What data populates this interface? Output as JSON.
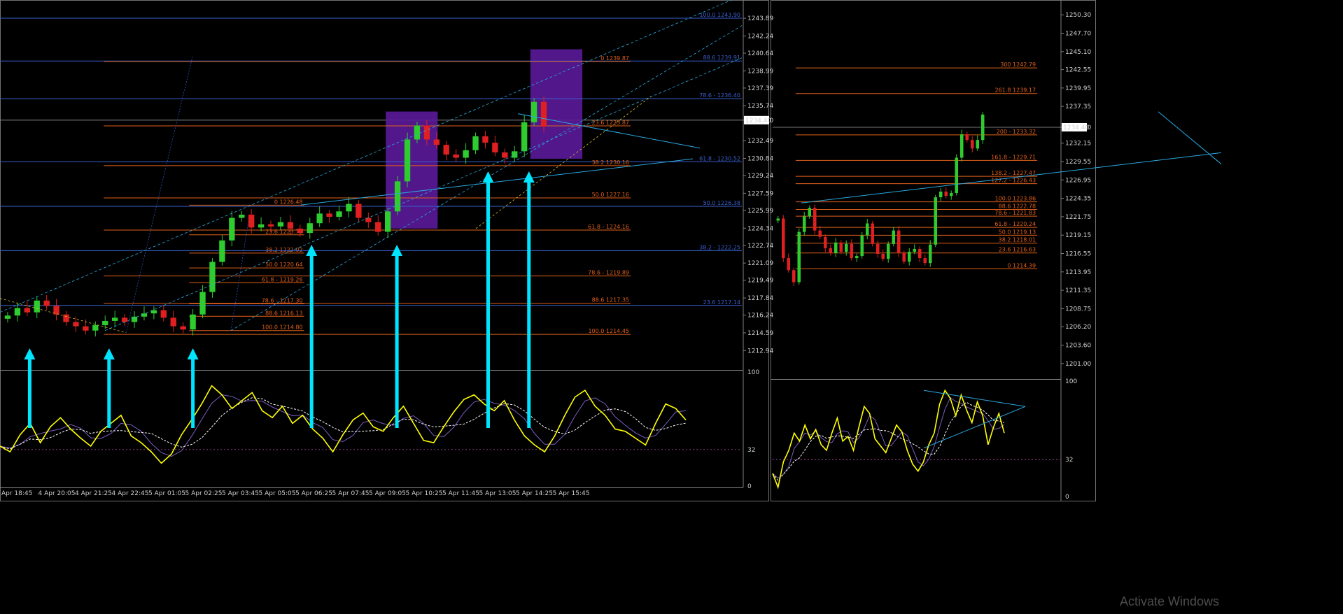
{
  "colors": {
    "background": "#000000",
    "bull": "#2ecc2e",
    "bear": "#e02020",
    "fib_blue": "#3a5fd0",
    "fib_orange": "#e0601a",
    "trend": "#2aa8e0",
    "arrow": "#00e5ff",
    "box": "#5a1a9a",
    "osc_main": "#ffff00",
    "osc_sig": "#7a5cc0",
    "osc_dash": "#ffffff",
    "axis_text": "#d0d0d0"
  },
  "watermark": "Activate Windows",
  "chart_data": [
    {
      "name": "left-price",
      "type": "candlestick",
      "ylim": [
        1211.2,
        1245.2
      ],
      "y_ticks": [
        "1243.89",
        "1242.24",
        "1240.64",
        "1238.99",
        "1237.39",
        "1235.74",
        "1234.40",
        "1232.49",
        "1230.84",
        "1229.24",
        "1227.59",
        "1225.99",
        "1224.34",
        "1222.74",
        "1221.09",
        "1219.49",
        "1217.84",
        "1216.24",
        "1214.59",
        "1212.94"
      ],
      "current_price": "1234.40",
      "x_ticks": [
        "Apr 18:45",
        "4 Apr 20:05",
        "4 Apr 21:25",
        "4 Apr 22:45",
        "5 Apr 01:05",
        "5 Apr 02:25",
        "5 Apr 03:45",
        "5 Apr 05:05",
        "5 Apr 06:25",
        "5 Apr 07:45",
        "5 Apr 09:05",
        "5 Apr 10:25",
        "5 Apr 11:45",
        "5 Apr 13:05",
        "5 Apr 14:25",
        "5 Apr 15:45"
      ],
      "close_path": [
        1216.2,
        1216.9,
        1216.5,
        1217.6,
        1217.1,
        1216.3,
        1215.6,
        1215.2,
        1214.8,
        1215.3,
        1215.7,
        1216.0,
        1215.6,
        1216.1,
        1216.4,
        1216.7,
        1216.0,
        1215.2,
        1214.9,
        1216.3,
        1218.4,
        1221.2,
        1223.2,
        1225.3,
        1225.6,
        1224.4,
        1224.7,
        1224.5,
        1224.9,
        1224.3,
        1223.9,
        1224.8,
        1225.7,
        1225.4,
        1225.9,
        1226.6,
        1225.3,
        1224.9,
        1224.0,
        1225.9,
        1228.7,
        1232.6,
        1233.9,
        1232.6,
        1232.1,
        1231.2,
        1230.9,
        1231.6,
        1232.9,
        1232.3,
        1231.4,
        1230.9,
        1231.5,
        1234.2,
        1236.1,
        1233.8
      ],
      "fib_levels": [
        {
          "label": "100.0 1243.90",
          "value": 1243.9,
          "color": "blue",
          "x0": 0.0,
          "x1": 1.0
        },
        {
          "label": "88.6 1239.91",
          "value": 1239.91,
          "color": "blue",
          "x0": 0.0,
          "x1": 1.0
        },
        {
          "label": "0 1239.87",
          "value": 1239.87,
          "color": "orange",
          "x0": 0.14,
          "x1": 0.85
        },
        {
          "label": "78.6 - 1236.40",
          "value": 1236.4,
          "color": "blue",
          "x0": 0.0,
          "x1": 1.0
        },
        {
          "label": "23.6 1233.87",
          "value": 1233.87,
          "color": "orange",
          "x0": 0.14,
          "x1": 0.85
        },
        {
          "label": "61.8 - 1230.52",
          "value": 1230.52,
          "color": "blue",
          "x0": 0.0,
          "x1": 1.0
        },
        {
          "label": "38.2 1230.16",
          "value": 1230.16,
          "color": "orange",
          "x0": 0.14,
          "x1": 0.85
        },
        {
          "label": "50.0 1227.16",
          "value": 1227.16,
          "color": "orange",
          "x0": 0.14,
          "x1": 0.85
        },
        {
          "label": "0 1226.48",
          "value": 1226.48,
          "color": "orange",
          "x0": 0.255,
          "x1": 0.41
        },
        {
          "label": "50.0 1226.38",
          "value": 1226.38,
          "color": "blue",
          "x0": 0.0,
          "x1": 1.0
        },
        {
          "label": "61.8 - 1224.16",
          "value": 1224.16,
          "color": "orange",
          "x0": 0.14,
          "x1": 0.85
        },
        {
          "label": "23.6 1223.72",
          "value": 1223.72,
          "color": "orange",
          "x0": 0.255,
          "x1": 0.41
        },
        {
          "label": "38.2 1222.02",
          "value": 1222.02,
          "color": "orange",
          "x0": 0.255,
          "x1": 0.41
        },
        {
          "label": "38.2 - 1222.25",
          "value": 1222.25,
          "color": "blue",
          "x0": 0.0,
          "x1": 1.0
        },
        {
          "label": "50.0 1220.64",
          "value": 1220.64,
          "color": "orange",
          "x0": 0.255,
          "x1": 0.41
        },
        {
          "label": "78.6 - 1219.89",
          "value": 1219.89,
          "color": "orange",
          "x0": 0.14,
          "x1": 0.85
        },
        {
          "label": "61.8 - 1219.26",
          "value": 1219.26,
          "color": "orange",
          "x0": 0.255,
          "x1": 0.41
        },
        {
          "label": "78.6 - 1217.30",
          "value": 1217.3,
          "color": "orange",
          "x0": 0.255,
          "x1": 0.41
        },
        {
          "label": "88.6 1217.35",
          "value": 1217.35,
          "color": "orange",
          "x0": 0.14,
          "x1": 0.85
        },
        {
          "label": "23.6 1217.14",
          "value": 1217.14,
          "color": "blue",
          "x0": 0.0,
          "x1": 1.0
        },
        {
          "label": "88.6 1216.13",
          "value": 1216.13,
          "color": "orange",
          "x0": 0.255,
          "x1": 0.41
        },
        {
          "label": "100.0 1214.80",
          "value": 1214.8,
          "color": "orange",
          "x0": 0.255,
          "x1": 0.41
        },
        {
          "label": "100.0 1214.45",
          "value": 1214.45,
          "color": "orange",
          "x0": 0.14,
          "x1": 0.85
        }
      ],
      "boxes": [
        {
          "t0": 0.52,
          "t1": 0.59,
          "p0": 1235.2,
          "p1": 1224.3
        },
        {
          "t0": 0.715,
          "t1": 0.785,
          "p0": 1241.0,
          "p1": 1230.8
        }
      ],
      "arrows_t": [
        0.04,
        0.147,
        0.26,
        0.42,
        0.535,
        0.658,
        0.713
      ]
    },
    {
      "name": "left-oscillator",
      "type": "line",
      "ylim": [
        0,
        100
      ],
      "y_ticks": [
        "100",
        "32",
        "0"
      ],
      "level": 32,
      "series": [
        {
          "name": "",
          "values": [
            35,
            30,
            45,
            55,
            38,
            52,
            60,
            50,
            42,
            35,
            48,
            55,
            62,
            44,
            38,
            30,
            20,
            28,
            45,
            58,
            72,
            88,
            80,
            68,
            75,
            82,
            66,
            60,
            70,
            55,
            62,
            50,
            42,
            30,
            45,
            58,
            64,
            52,
            48,
            60,
            70,
            55,
            40,
            38,
            52,
            65,
            76,
            80,
            72,
            66,
            75,
            58,
            44,
            36,
            30,
            44,
            62,
            78,
            84,
            70,
            62,
            50,
            48,
            42,
            36,
            55,
            72,
            68,
            58
          ]
        }
      ]
    },
    {
      "name": "right-price",
      "type": "candlestick",
      "ylim": [
        1199.0,
        1251.8
      ],
      "y_ticks": [
        "1250.30",
        "1247.70",
        "1245.10",
        "1242.55",
        "1239.95",
        "1237.35",
        "1234.40",
        "1232.15",
        "1229.55",
        "1226.95",
        "1224.35",
        "1221.75",
        "1219.15",
        "1216.55",
        "1213.95",
        "1211.35",
        "1208.75",
        "1206.20",
        "1203.60",
        "1201.00"
      ],
      "current_price": "1234.40",
      "close_path": [
        1221.5,
        1215.9,
        1214.2,
        1212.5,
        1219.6,
        1221.8,
        1223.0,
        1219.8,
        1218.9,
        1217.3,
        1216.6,
        1218.1,
        1216.8,
        1217.9,
        1215.9,
        1216.2,
        1219.1,
        1220.8,
        1217.9,
        1216.5,
        1215.8,
        1217.9,
        1219.8,
        1216.6,
        1215.4,
        1216.8,
        1217.2,
        1215.9,
        1215.2,
        1217.8,
        1224.5,
        1225.3,
        1224.7,
        1225.1,
        1230.1,
        1233.4,
        1232.6,
        1231.4,
        1232.6,
        1236.2
      ],
      "fib_levels": [
        {
          "label": "300 1242.79",
          "value": 1242.79,
          "color": "orange",
          "x0": 0.08,
          "x1": 0.92
        },
        {
          "label": "261.8 1239.17",
          "value": 1239.17,
          "color": "orange",
          "x0": 0.08,
          "x1": 0.92
        },
        {
          "label": "200 - 1233.32",
          "value": 1233.32,
          "color": "orange",
          "x0": 0.08,
          "x1": 0.92
        },
        {
          "label": "161.8 - 1229.71",
          "value": 1229.71,
          "color": "orange",
          "x0": 0.08,
          "x1": 0.92
        },
        {
          "label": "138.2 - 1227.47",
          "value": 1227.47,
          "color": "orange",
          "x0": 0.08,
          "x1": 0.92
        },
        {
          "label": "127.2 - 1226.43",
          "value": 1226.43,
          "color": "orange",
          "x0": 0.08,
          "x1": 0.92
        },
        {
          "label": "100.0 1223.86",
          "value": 1223.86,
          "color": "orange",
          "x0": 0.08,
          "x1": 0.92
        },
        {
          "label": "88.6 1222.78",
          "value": 1222.78,
          "color": "orange",
          "x0": 0.08,
          "x1": 0.92
        },
        {
          "label": "78.6 - 1221.83",
          "value": 1221.83,
          "color": "orange",
          "x0": 0.08,
          "x1": 0.92
        },
        {
          "label": "61.8 - 1220.24",
          "value": 1220.24,
          "color": "orange",
          "x0": 0.08,
          "x1": 0.92
        },
        {
          "label": "50.0 1219.13",
          "value": 1219.13,
          "color": "orange",
          "x0": 0.08,
          "x1": 0.92
        },
        {
          "label": "38.2 1218.01",
          "value": 1218.01,
          "color": "orange",
          "x0": 0.08,
          "x1": 0.92
        },
        {
          "label": "23.6 1216.63",
          "value": 1216.63,
          "color": "orange",
          "x0": 0.08,
          "x1": 0.92
        },
        {
          "label": "0 1214.39",
          "value": 1214.39,
          "color": "orange",
          "x0": 0.08,
          "x1": 0.92
        }
      ]
    },
    {
      "name": "right-oscillator",
      "type": "line",
      "ylim": [
        0,
        100
      ],
      "y_ticks": [
        "100",
        "32",
        "0"
      ],
      "level": 32,
      "series": [
        {
          "name": "",
          "values": [
            20,
            8,
            30,
            40,
            55,
            48,
            62,
            50,
            58,
            45,
            40,
            55,
            68,
            48,
            52,
            40,
            60,
            78,
            72,
            50,
            44,
            38,
            50,
            62,
            56,
            40,
            28,
            22,
            30,
            45,
            55,
            80,
            92,
            85,
            70,
            88,
            75,
            64,
            82,
            70,
            45,
            60,
            72,
            55
          ]
        }
      ]
    }
  ]
}
